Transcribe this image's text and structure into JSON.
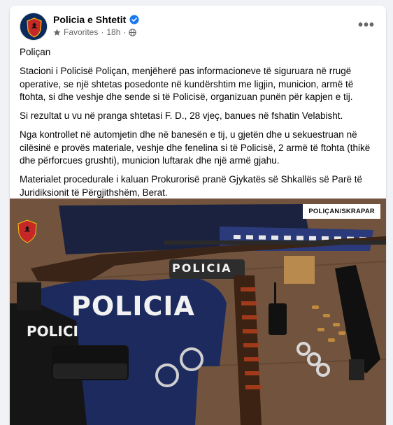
{
  "post": {
    "page_name": "Policia e Shtetit",
    "audience_label": "Favorites",
    "time": "18h",
    "paragraphs": [
      "Poliçan",
      "Stacioni i Policisë Poliçan, menjëherë pas informacioneve të siguruara në rrugë operative, se një shtetas posedonte në kundërshtim me ligjin, municion, armë të ftohta, si dhe veshje dhe sende si të Policisë, organizuan punën për kapjen e tij.",
      "Si rezultat u vu në pranga shtetasi F. D., 28 vjeç, banues në fshatin Velabisht.",
      "Nga kontrollet në automjetin dhe në banesën e tij, u gjetën dhe u sekuestruan në cilësinë e provës materiale, veshje dhe fenelina si të Policisë, 2 armë të ftohta (thikë dhe përforcues grushti), municion  luftarak dhe një armë gjahu.",
      "Materialet procedurale i kaluan Prokurorisë pranë Gjykatës së Shkallës së Parë të Juridiksionit të Përgjithshëm, Berat."
    ]
  },
  "photo": {
    "tag": "POLIÇAN/SKRAPAR",
    "patch_text": "POLICIA",
    "shirt_text": "POLICIA",
    "vest_text": "POLICI"
  },
  "icons": {
    "verified": "verified-badge-icon",
    "favorites": "star-icon",
    "globe": "globe-icon",
    "more": "more-options-icon"
  },
  "colors": {
    "verified_blue": "#1877f2",
    "secondary_text": "#65676b",
    "background": "#f0f2f5"
  }
}
